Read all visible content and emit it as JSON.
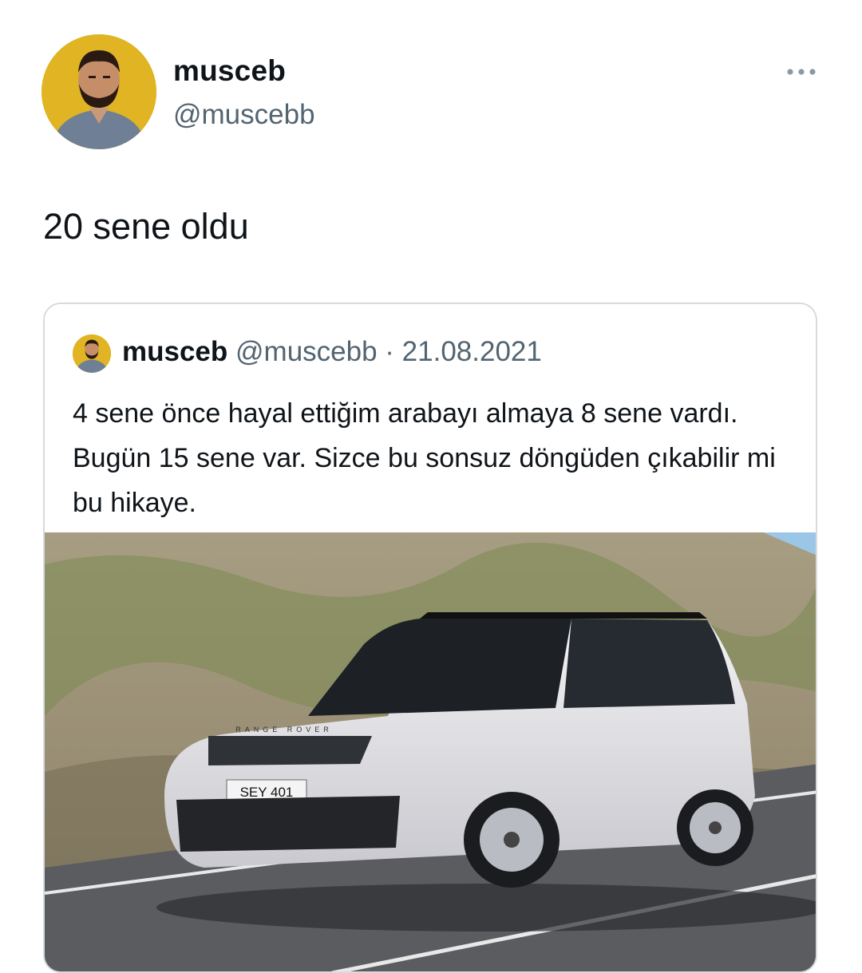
{
  "tweet": {
    "display_name": "musceb",
    "handle": "@muscebb",
    "text": "20 sene oldu",
    "more_icon": "more-horizontal-icon"
  },
  "quote": {
    "display_name": "musceb",
    "handle": "@muscebb",
    "separator": " · ",
    "date": "21.08.2021",
    "text": "4 sene önce hayal ettiğim arabayı almaya 8 sene vardı. Bugün 15 sene var. Sizce bu sonsuz döngüden çıkabilir mi bu hikaye.",
    "media": {
      "description_plate": "SEY 401",
      "badge_text": "RANGE ROVER"
    }
  },
  "colors": {
    "avatar_bg": "#e0b422",
    "secondary_text": "#536471",
    "card_border": "#d6dbe0"
  }
}
